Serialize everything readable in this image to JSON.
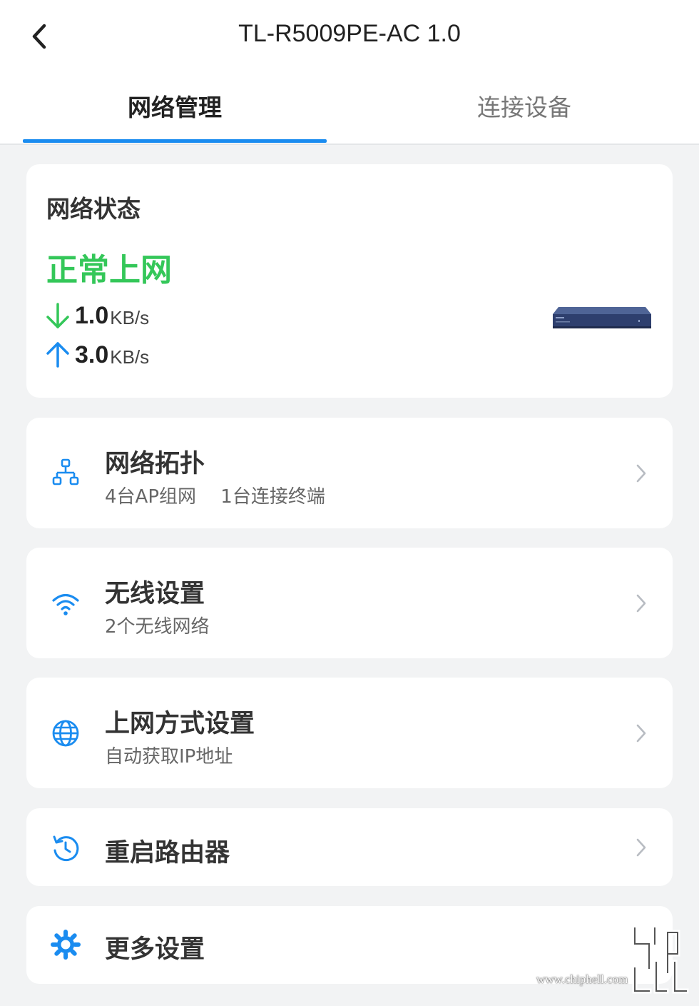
{
  "header": {
    "title": "TL-R5009PE-AC 1.0",
    "back_icon": "chevron-left-icon",
    "tabs": [
      {
        "label": "网络管理",
        "active": true
      },
      {
        "label": "连接设备",
        "active": false
      }
    ],
    "accent_color": "#1a8cf0"
  },
  "status": {
    "heading": "网络状态",
    "state": "正常上网",
    "state_color": "#34c759",
    "download": {
      "value": "1.0",
      "unit": "KB/s",
      "icon": "arrow-down-icon",
      "color": "#34c759"
    },
    "upload": {
      "value": "3.0",
      "unit": "KB/s",
      "icon": "arrow-up-icon",
      "color": "#1a8cf0"
    },
    "device_image": "router-image"
  },
  "menu": [
    {
      "title": "网络拓扑",
      "subtitle": "4台AP组网　 1台连接终端",
      "icon": "topology-icon"
    },
    {
      "title": "无线设置",
      "subtitle": "2个无线网络",
      "icon": "wifi-icon"
    },
    {
      "title": "上网方式设置",
      "subtitle": "自动获取IP地址",
      "icon": "globe-icon"
    },
    {
      "title": "重启路由器",
      "icon": "restart-icon"
    },
    {
      "title": "更多设置",
      "icon": "gear-icon"
    }
  ],
  "watermark": {
    "text": "www.chiphell.com",
    "logo": "chiphell-logo"
  }
}
